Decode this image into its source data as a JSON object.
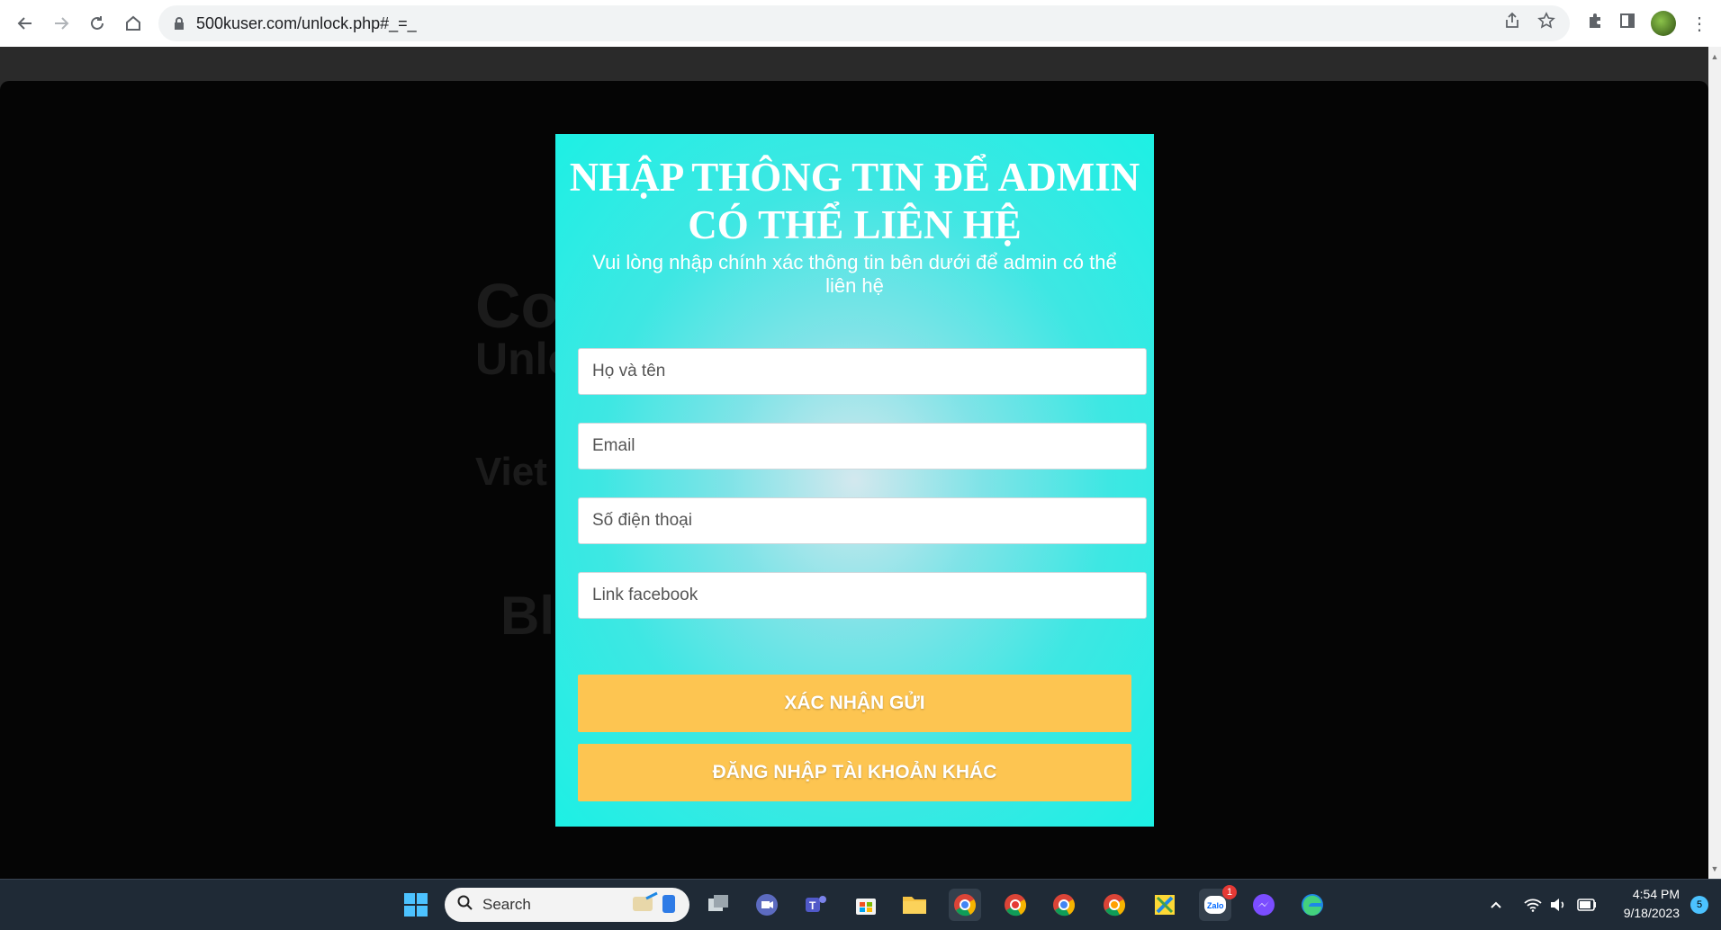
{
  "browser": {
    "url": "500kuser.com/unlock.php#_=_"
  },
  "background_page": {
    "ghost_texts": [
      "Co",
      "Unlo",
      "Viet",
      "Bl"
    ]
  },
  "modal": {
    "title": "NHẬP THÔNG TIN ĐỂ ADMIN CÓ THỂ LIÊN HỆ",
    "subtitle": "Vui lòng nhập chính xác thông tin bên dưới để admin có thể liên hệ",
    "fields": {
      "name_placeholder": "Họ và tên",
      "email_placeholder": "Email",
      "phone_placeholder": "Số điện thoại",
      "facebook_placeholder": "Link facebook"
    },
    "submit_label": "XÁC NHẬN GỬI",
    "other_account_label": "ĐĂNG NHẬP TÀI KHOẢN KHÁC",
    "accent_color": "#fdc551",
    "background_color": "#1df0e4"
  },
  "taskbar": {
    "search_label": "Search",
    "notification_count": "1",
    "zalo_badge": "1",
    "time": "4:54 PM",
    "date": "9/18/2023",
    "tray_badge": "5"
  }
}
